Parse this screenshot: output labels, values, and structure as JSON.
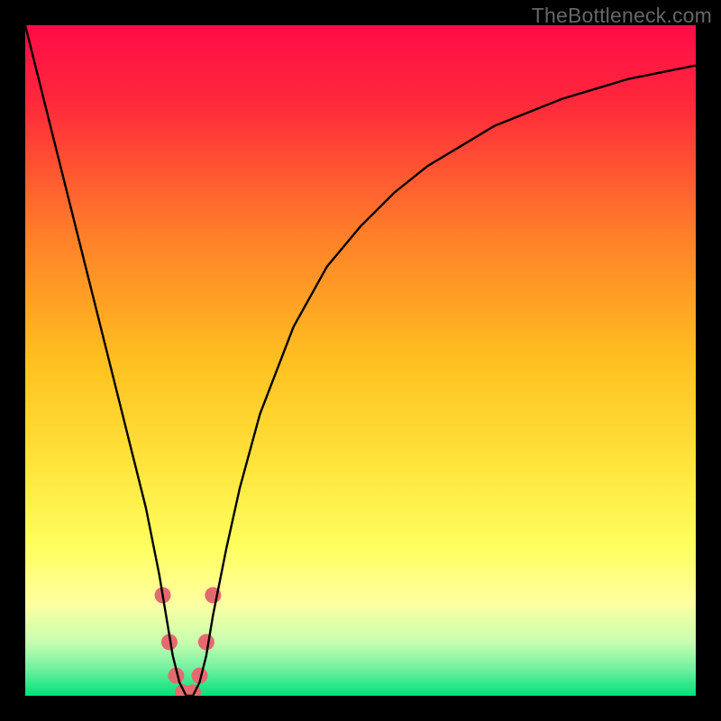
{
  "watermark": "TheBottleneck.com",
  "chart_data": {
    "type": "line",
    "title": "",
    "xlabel": "",
    "ylabel": "",
    "xlim": [
      0,
      100
    ],
    "ylim": [
      0,
      100
    ],
    "background": {
      "type": "vertical-gradient",
      "stops": [
        {
          "pos": 0.0,
          "color": "#ff0b48"
        },
        {
          "pos": 0.12,
          "color": "#ff2a3a"
        },
        {
          "pos": 0.3,
          "color": "#ff7a2a"
        },
        {
          "pos": 0.5,
          "color": "#ffc020"
        },
        {
          "pos": 0.65,
          "color": "#ffe33a"
        },
        {
          "pos": 0.78,
          "color": "#ffff60"
        },
        {
          "pos": 0.86,
          "color": "#ffffa0"
        },
        {
          "pos": 0.92,
          "color": "#c8ffb0"
        },
        {
          "pos": 0.96,
          "color": "#70f0a0"
        },
        {
          "pos": 1.0,
          "color": "#00e27a"
        }
      ]
    },
    "series": [
      {
        "name": "bottleneck-curve",
        "stroke": "#000000",
        "x": [
          0,
          2,
          4,
          6,
          8,
          10,
          12,
          14,
          16,
          18,
          20,
          21,
          22,
          23,
          24,
          25,
          26,
          27,
          28,
          30,
          32,
          35,
          40,
          45,
          50,
          55,
          60,
          65,
          70,
          75,
          80,
          85,
          90,
          95,
          100
        ],
        "y": [
          100,
          92,
          84,
          76,
          68,
          60,
          52,
          44,
          36,
          28,
          18,
          12,
          6,
          2,
          0,
          0,
          2,
          6,
          12,
          22,
          31,
          42,
          55,
          64,
          70,
          75,
          79,
          82,
          85,
          87,
          89,
          90.5,
          92,
          93,
          94
        ]
      }
    ],
    "markers": {
      "name": "highlight-dots",
      "color": "#e46a6f",
      "radius_px": 9,
      "points": [
        {
          "x": 20.5,
          "y": 15
        },
        {
          "x": 21.5,
          "y": 8
        },
        {
          "x": 22.5,
          "y": 3
        },
        {
          "x": 23.5,
          "y": 0.5
        },
        {
          "x": 25.0,
          "y": 0.5
        },
        {
          "x": 26.0,
          "y": 3
        },
        {
          "x": 27.0,
          "y": 8
        },
        {
          "x": 28.0,
          "y": 15
        }
      ]
    }
  }
}
